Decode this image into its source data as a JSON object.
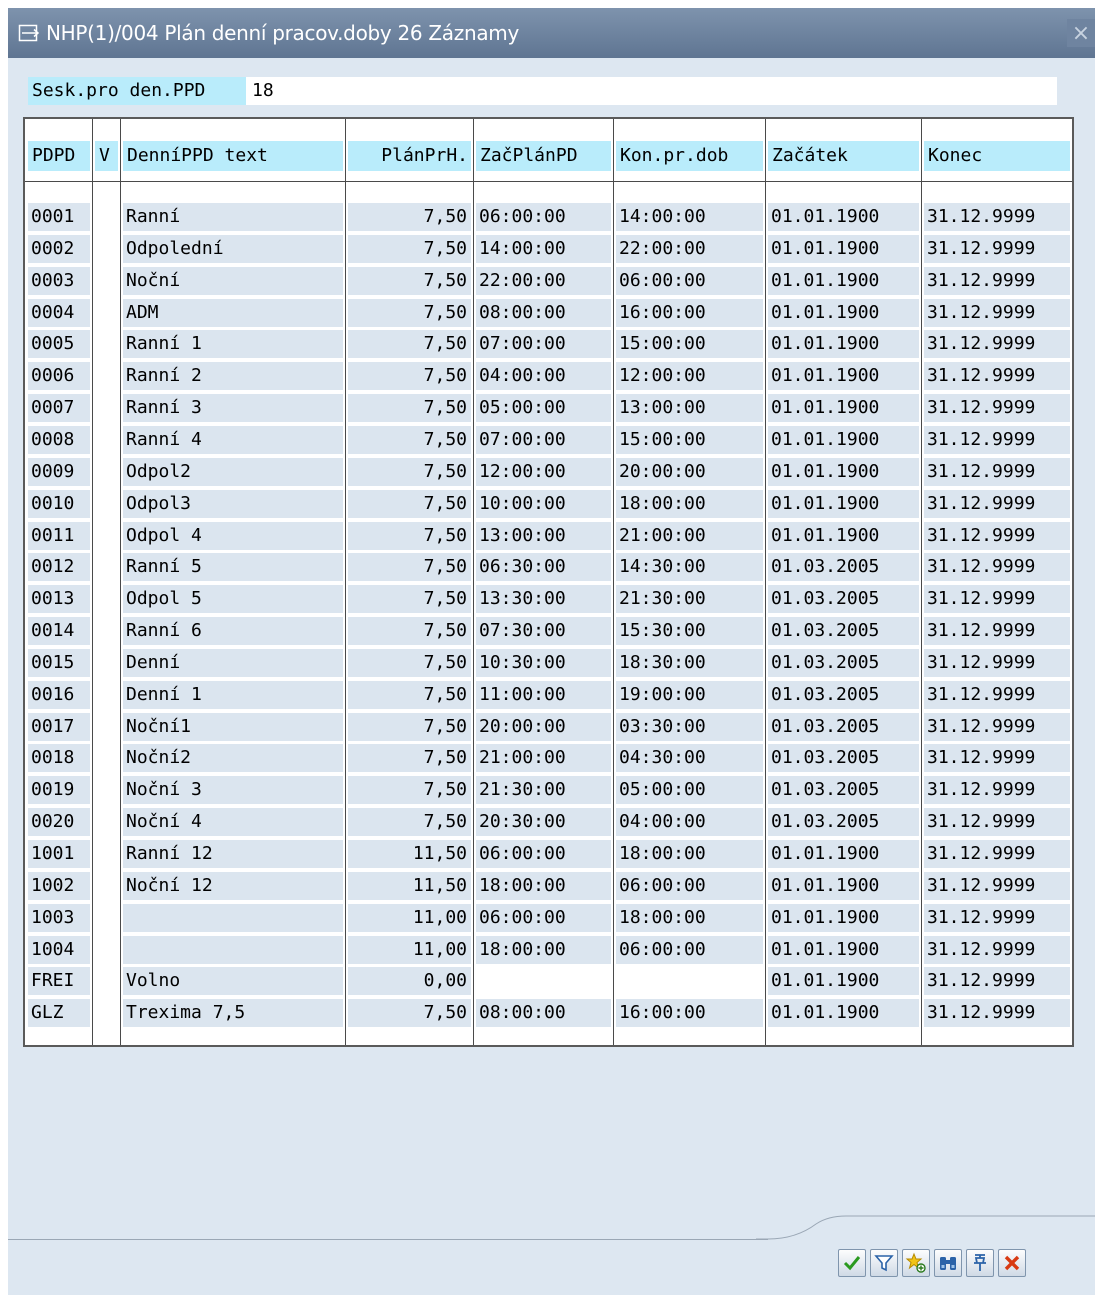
{
  "window": {
    "title": "NHP(1)/004 Plán denní pracov.doby 26 Záznamy",
    "close_glyph": "×"
  },
  "selection": {
    "label": "Sesk.pro den.PPD",
    "value": "18"
  },
  "table": {
    "columns": [
      "PDPD",
      "V",
      "DenníPPD text",
      "PlánPrH.",
      "ZačPlánPD",
      "Kon.pr.dob",
      "Začátek",
      "Konec"
    ],
    "rows": [
      [
        "0001",
        "",
        "Ranní",
        "7,50",
        "06:00:00",
        "14:00:00",
        "01.01.1900",
        "31.12.9999"
      ],
      [
        "0002",
        "",
        "Odpolední",
        "7,50",
        "14:00:00",
        "22:00:00",
        "01.01.1900",
        "31.12.9999"
      ],
      [
        "0003",
        "",
        "Noční",
        "7,50",
        "22:00:00",
        "06:00:00",
        "01.01.1900",
        "31.12.9999"
      ],
      [
        "0004",
        "",
        "ADM",
        "7,50",
        "08:00:00",
        "16:00:00",
        "01.01.1900",
        "31.12.9999"
      ],
      [
        "0005",
        "",
        "Ranní 1",
        "7,50",
        "07:00:00",
        "15:00:00",
        "01.01.1900",
        "31.12.9999"
      ],
      [
        "0006",
        "",
        "Ranní 2",
        "7,50",
        "04:00:00",
        "12:00:00",
        "01.01.1900",
        "31.12.9999"
      ],
      [
        "0007",
        "",
        "Ranní 3",
        "7,50",
        "05:00:00",
        "13:00:00",
        "01.01.1900",
        "31.12.9999"
      ],
      [
        "0008",
        "",
        "Ranní 4",
        "7,50",
        "07:00:00",
        "15:00:00",
        "01.01.1900",
        "31.12.9999"
      ],
      [
        "0009",
        "",
        "Odpol2",
        "7,50",
        "12:00:00",
        "20:00:00",
        "01.01.1900",
        "31.12.9999"
      ],
      [
        "0010",
        "",
        "Odpol3",
        "7,50",
        "10:00:00",
        "18:00:00",
        "01.01.1900",
        "31.12.9999"
      ],
      [
        "0011",
        "",
        "Odpol 4",
        "7,50",
        "13:00:00",
        "21:00:00",
        "01.01.1900",
        "31.12.9999"
      ],
      [
        "0012",
        "",
        "Ranní 5",
        "7,50",
        "06:30:00",
        "14:30:00",
        "01.03.2005",
        "31.12.9999"
      ],
      [
        "0013",
        "",
        "Odpol 5",
        "7,50",
        "13:30:00",
        "21:30:00",
        "01.03.2005",
        "31.12.9999"
      ],
      [
        "0014",
        "",
        "Ranní 6",
        "7,50",
        "07:30:00",
        "15:30:00",
        "01.03.2005",
        "31.12.9999"
      ],
      [
        "0015",
        "",
        "Denní",
        "7,50",
        "10:30:00",
        "18:30:00",
        "01.03.2005",
        "31.12.9999"
      ],
      [
        "0016",
        "",
        "Denní 1",
        "7,50",
        "11:00:00",
        "19:00:00",
        "01.03.2005",
        "31.12.9999"
      ],
      [
        "0017",
        "",
        "Noční1",
        "7,50",
        "20:00:00",
        "03:30:00",
        "01.03.2005",
        "31.12.9999"
      ],
      [
        "0018",
        "",
        "Noční2",
        "7,50",
        "21:00:00",
        "04:30:00",
        "01.03.2005",
        "31.12.9999"
      ],
      [
        "0019",
        "",
        "Noční 3",
        "7,50",
        "21:30:00",
        "05:00:00",
        "01.03.2005",
        "31.12.9999"
      ],
      [
        "0020",
        "",
        "Noční 4",
        "7,50",
        "20:30:00",
        "04:00:00",
        "01.03.2005",
        "31.12.9999"
      ],
      [
        "1001",
        "",
        "Ranní 12",
        "11,50",
        "06:00:00",
        "18:00:00",
        "01.01.1900",
        "31.12.9999"
      ],
      [
        "1002",
        "",
        "Noční 12",
        "11,50",
        "18:00:00",
        "06:00:00",
        "01.01.1900",
        "31.12.9999"
      ],
      [
        "1003",
        "",
        "",
        "11,00",
        "06:00:00",
        "18:00:00",
        "01.01.1900",
        "31.12.9999"
      ],
      [
        "1004",
        "",
        "",
        "11,00",
        "18:00:00",
        "06:00:00",
        "01.01.1900",
        "31.12.9999"
      ],
      [
        "FREI",
        "",
        "Volno",
        "0,00",
        "",
        "",
        "01.01.1900",
        "31.12.9999"
      ],
      [
        "GLZ",
        "",
        "Trexima 7,5",
        "7,50",
        "08:00:00",
        "16:00:00",
        "01.01.1900",
        "31.12.9999"
      ]
    ]
  },
  "toolbar": {
    "buttons": [
      {
        "name": "continue-button",
        "icon": "checkmark-icon"
      },
      {
        "name": "filter-button",
        "icon": "filter-icon"
      },
      {
        "name": "add-favorite-button",
        "icon": "star-add-icon"
      },
      {
        "name": "find-button",
        "icon": "binoculars-icon"
      },
      {
        "name": "pin-button",
        "icon": "pin-icon"
      },
      {
        "name": "cancel-button",
        "icon": "close-icon"
      }
    ]
  },
  "colors": {
    "header_bg": "#b9ecfb",
    "cell_bg": "#dbe5ef",
    "titlebar": "#6c819e"
  }
}
